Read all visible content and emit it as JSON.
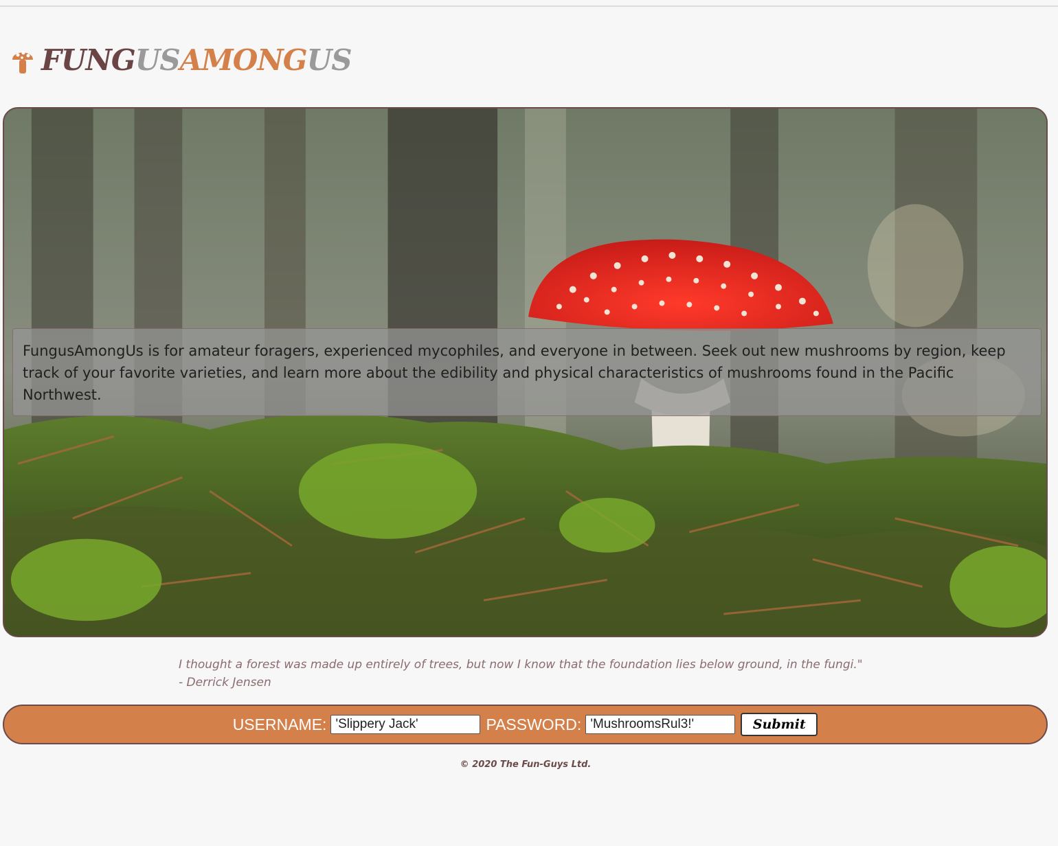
{
  "brand": {
    "name_parts": [
      {
        "text": "FUNG",
        "color": "#6b4446"
      },
      {
        "text": "US",
        "color": "#9a9a9a"
      },
      {
        "text": "AMONG",
        "color": "#d4804b"
      },
      {
        "text": "US",
        "color": "#9a9a9a"
      }
    ],
    "icon": "mushroom-icon",
    "icon_color": "#d4804b"
  },
  "hero": {
    "intro_text": "FungusAmongUs is for amateur foragers, experienced mycophiles, and everyone in between. Seek out new mushrooms by region, keep track of your favorite varieties, and learn more about the edibility and physical characteristics of mushrooms found in the Pacific Northwest."
  },
  "quote": {
    "text": "I thought a forest was made up entirely of trees, but now I know that the foundation lies below ground, in the fungi.\"",
    "author": "- Derrick Jensen"
  },
  "login": {
    "username_label": "USERNAME:",
    "username_value": "'Slippery Jack'",
    "password_label": "PASSWORD:",
    "password_value": "'MushroomsRul3!'",
    "submit_label": "Submit"
  },
  "footer": {
    "copyright": "© 2020 The Fun-Guys Ltd."
  },
  "colors": {
    "accent": "#d4804b",
    "border": "#6b4a4a",
    "background": "#f7f7f7"
  }
}
